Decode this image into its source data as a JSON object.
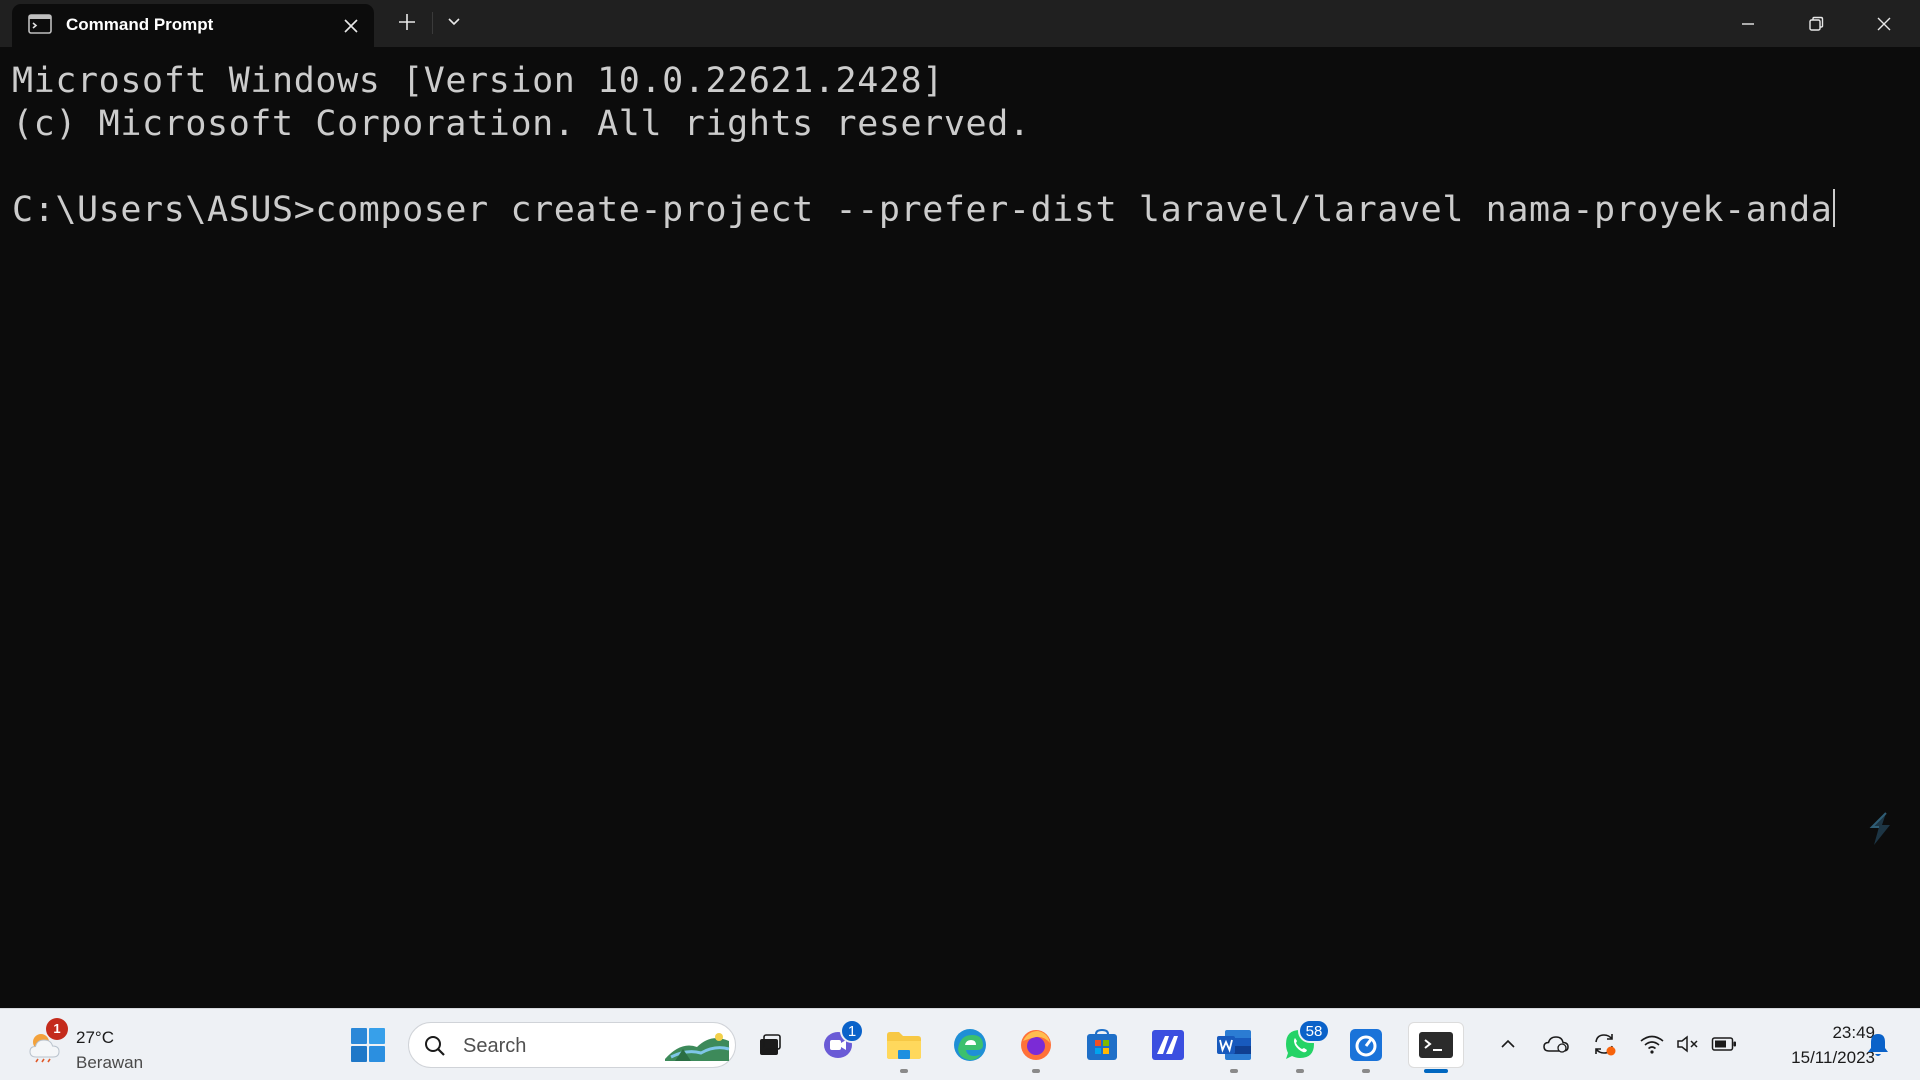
{
  "window": {
    "tab_title": "Command Prompt",
    "icons": {
      "tab": "command-prompt-icon",
      "close_tab": "close-icon",
      "new_tab": "plus-icon",
      "dropdown": "chevron-down-icon",
      "minimize": "minimize-icon",
      "maximize": "restore-icon",
      "close": "close-icon"
    }
  },
  "terminal": {
    "lines": [
      "Microsoft Windows [Version 10.0.22621.2428]",
      "(c) Microsoft Corporation. All rights reserved.",
      "",
      "C:\\Users\\ASUS>composer create-project --prefer-dist laravel/laravel nama-proyek-anda"
    ],
    "foreground": "#cccccc",
    "background": "#0c0c0c"
  },
  "taskbar": {
    "weather": {
      "temperature": "27°C",
      "condition": "Berawan",
      "badge": "1"
    },
    "search": {
      "placeholder": "Search"
    },
    "apps": [
      {
        "name": "start",
        "icon": "windows-logo-icon"
      },
      {
        "name": "task-view",
        "icon": "task-view-icon"
      },
      {
        "name": "teams-chat",
        "icon": "teams-chat-icon",
        "badge": "1"
      },
      {
        "name": "file-explorer",
        "icon": "folder-icon"
      },
      {
        "name": "edge",
        "icon": "edge-icon"
      },
      {
        "name": "firefox",
        "icon": "firefox-icon"
      },
      {
        "name": "microsoft-store",
        "icon": "store-icon"
      },
      {
        "name": "visual-studio",
        "icon": "visual-studio-icon"
      },
      {
        "name": "word",
        "icon": "word-icon"
      },
      {
        "name": "whatsapp",
        "icon": "whatsapp-icon",
        "badge": "58"
      },
      {
        "name": "app-blue",
        "icon": "blue-app-icon"
      },
      {
        "name": "terminal",
        "icon": "terminal-icon",
        "active": true
      }
    ],
    "tray": {
      "icons": [
        "chevron-up-icon",
        "onedrive-icon",
        "sync-icon",
        "wifi-icon",
        "speaker-muted-icon",
        "battery-icon"
      ]
    },
    "clock": {
      "time": "23:49",
      "date": "15/11/2023"
    },
    "accent": "#0067c0"
  }
}
